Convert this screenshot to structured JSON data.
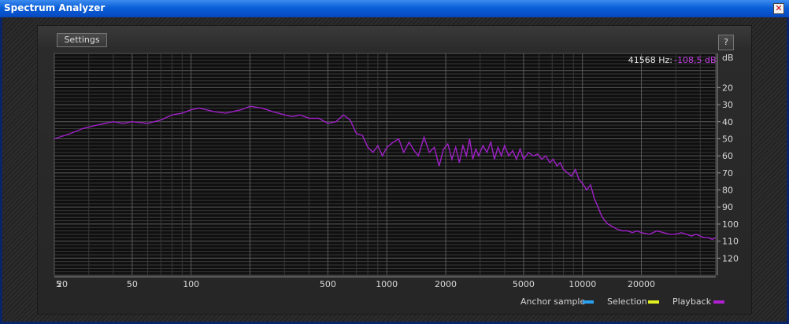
{
  "window": {
    "title": "Spectrum Analyzer",
    "close_label": "✕"
  },
  "toolbar": {
    "settings_label": "Settings",
    "help_label": "?"
  },
  "readout": {
    "freq_text": "41568 Hz:",
    "level_text": "-108,5 dB"
  },
  "legend": [
    {
      "label": "Anchor sample",
      "color": "#2aa0f0"
    },
    {
      "label": "Selection",
      "color": "#e0f020"
    },
    {
      "label": "Playback",
      "color": "#b020d0"
    }
  ],
  "colors": {
    "spectrum": "#a020c8",
    "grid_major": "#5a5a5a",
    "grid_minor": "#383838",
    "plot_bg": "#0f0f0f",
    "level_text": "#c040e0"
  },
  "chart_data": {
    "type": "line",
    "x_scale": "log",
    "xlim": [
      20,
      48000
    ],
    "ylim": [
      0,
      130
    ],
    "y_inverted": true,
    "ylabel": "dB",
    "x_ticks": [
      "20",
      "50",
      "100",
      "500",
      "1000",
      "2000",
      "5000",
      "10000",
      "20000"
    ],
    "x_tick_values": [
      20,
      50,
      100,
      500,
      1000,
      2000,
      5000,
      10000,
      20000
    ],
    "x_edge_label": "5",
    "y_ticks": [
      "20",
      "30",
      "40",
      "50",
      "60",
      "70",
      "80",
      "90",
      "100",
      "110",
      "120"
    ],
    "y_tick_values": [
      20,
      30,
      40,
      50,
      60,
      70,
      80,
      90,
      100,
      110,
      120
    ],
    "series": [
      {
        "x": [
          20,
          24,
          28,
          33,
          40,
          45,
          50,
          60,
          70,
          80,
          90,
          100,
          110,
          130,
          150,
          180,
          200,
          230,
          260,
          300,
          330,
          360,
          400,
          450,
          500,
          550,
          600,
          650,
          700,
          750,
          800,
          850,
          900,
          950,
          1000,
          1080,
          1150,
          1220,
          1300,
          1380,
          1450,
          1550,
          1650,
          1750,
          1850,
          1950,
          2050,
          2150,
          2250,
          2350,
          2450,
          2550,
          2650,
          2750,
          2850,
          2950,
          3100,
          3250,
          3400,
          3550,
          3700,
          3850,
          4000,
          4200,
          4400,
          4600,
          4800,
          5000,
          5300,
          5600,
          5900,
          6200,
          6500,
          6800,
          7100,
          7400,
          7700,
          8000,
          8400,
          8800,
          9200,
          9600,
          10000,
          10500,
          11000,
          11500,
          12000,
          12500,
          13000,
          13500,
          14000,
          15000,
          16000,
          17000,
          18000,
          19000,
          20000,
          22000,
          24000,
          26000,
          28000,
          30000,
          32000,
          34000,
          36000,
          38000,
          40000,
          42000,
          44000,
          46000,
          48000
        ],
        "y": [
          50,
          47,
          44,
          42,
          40,
          41,
          40,
          41,
          39,
          36,
          35,
          33,
          32,
          34,
          35,
          33,
          31,
          32,
          34,
          36,
          37,
          36,
          38,
          38,
          41,
          40,
          36,
          39,
          47,
          48,
          55,
          58,
          54,
          60,
          55,
          52,
          50,
          58,
          52,
          57,
          60,
          49,
          58,
          55,
          66,
          56,
          53,
          62,
          55,
          64,
          54,
          60,
          50,
          62,
          56,
          60,
          54,
          58,
          52,
          62,
          55,
          60,
          54,
          60,
          57,
          62,
          56,
          62,
          58,
          60,
          59,
          62,
          60,
          64,
          62,
          66,
          64,
          68,
          70,
          72,
          68,
          74,
          76,
          80,
          77,
          85,
          90,
          95,
          98,
          100,
          101,
          103,
          104,
          104,
          105,
          104,
          105,
          106,
          104,
          105,
          106,
          106,
          105,
          106,
          107,
          106,
          107,
          108,
          108,
          109,
          108
        ]
      }
    ]
  }
}
